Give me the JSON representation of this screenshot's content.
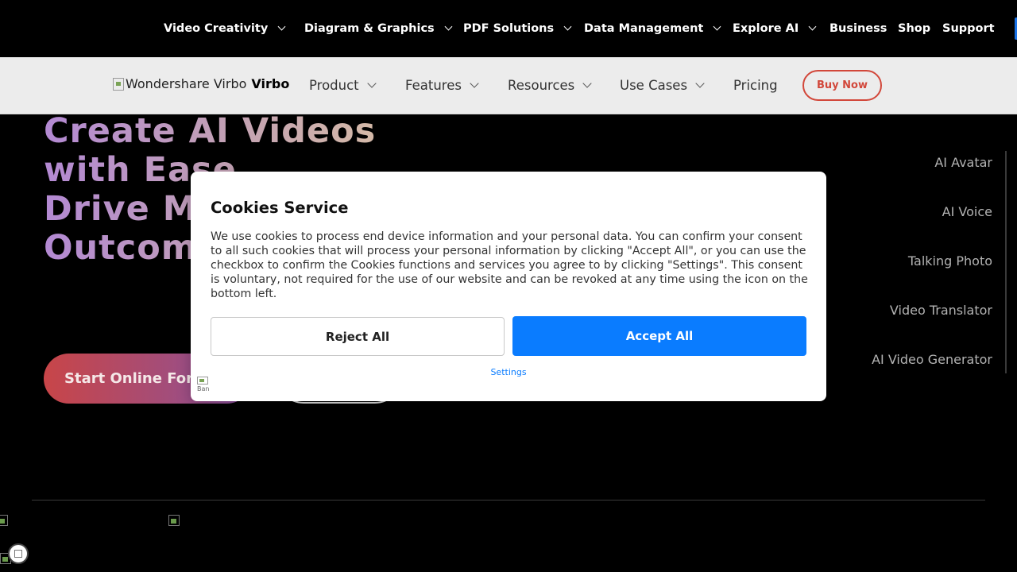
{
  "topnav": {
    "items": [
      {
        "label": "Video Creativity",
        "dropdown": true
      },
      {
        "label": "Diagram & Graphics",
        "dropdown": true
      },
      {
        "label": "PDF Solutions",
        "dropdown": true
      },
      {
        "label": "Data Management",
        "dropdown": true
      },
      {
        "label": "Explore AI",
        "dropdown": true
      },
      {
        "label": "Business",
        "dropdown": false
      },
      {
        "label": "Shop",
        "dropdown": false
      },
      {
        "label": "Support",
        "dropdown": false
      }
    ]
  },
  "prodnav": {
    "logo_alt": "Wondershare Virbo",
    "brand": "Virbo",
    "items": [
      {
        "label": "Product"
      },
      {
        "label": "Features"
      },
      {
        "label": "Resources"
      },
      {
        "label": "Use Cases"
      },
      {
        "label": "Pricing"
      }
    ],
    "buy_label": "Buy Now",
    "accent_color": "#d2473a"
  },
  "hero": {
    "title_lines": [
      "Create AI Videos",
      "with Ease",
      "Drive Mo",
      "Outcom"
    ],
    "start_label": "Start Online For"
  },
  "right_list": [
    "AI Avatar",
    "AI Voice",
    "Talking Photo",
    "Video Translator",
    "AI Video Generator"
  ],
  "cookie_modal": {
    "title": "Cookies Service",
    "text": "We use cookies to process end device information and your personal data. You can confirm your consent to all such cookies that will process your personal information by clicking \"Accept All\", or you can use the checkbox to confirm the Cookies functions and services you agree to by clicking \"Settings\". This consent is voluntary, not required for the use of our website and can be revoked at any time using the icon on the bottom left.",
    "reject_label": "Reject All",
    "accept_label": "Accept All",
    "settings_label": "Settings",
    "logo_alt": "Ban",
    "accept_color": "#0a7cff"
  }
}
